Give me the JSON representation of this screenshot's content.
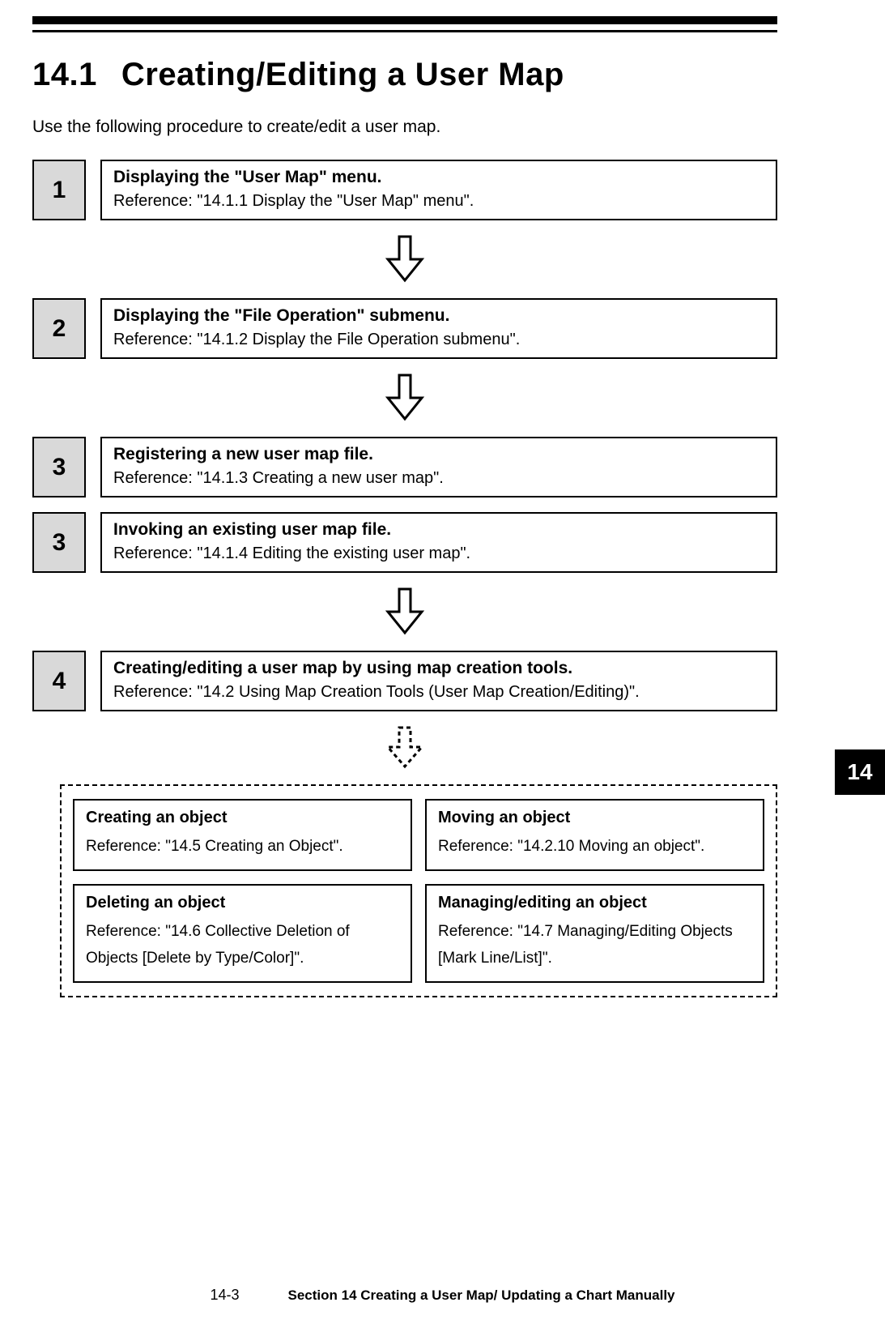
{
  "heading": {
    "number": "14.1",
    "title": "Creating/Editing a User Map"
  },
  "intro": "Use the following procedure to create/edit a user map.",
  "steps": [
    {
      "n": "1",
      "title": "Displaying the \"User Map\" menu.",
      "ref": "Reference: \"14.1.1 Display the \"User Map\" menu\"."
    },
    {
      "n": "2",
      "title": "Displaying the \"File Operation\" submenu.",
      "ref": "Reference: \"14.1.2 Display the File Operation submenu\"."
    },
    {
      "n": "3",
      "title": "Registering a new user map file.",
      "ref": "Reference: \"14.1.3 Creating a new user map\"."
    },
    {
      "n": "3",
      "title": "Invoking an existing user map file.",
      "ref": "Reference: \"14.1.4 Editing the existing user map\"."
    },
    {
      "n": "4",
      "title": "Creating/editing a user map by using map creation tools.",
      "ref": "Reference: \"14.2 Using Map Creation Tools (User Map Creation/Editing)\"."
    }
  ],
  "sub": {
    "a": {
      "title": "Creating an object",
      "ref": "Reference: \"14.5 Creating an Object\"."
    },
    "b": {
      "title": "Moving an object",
      "ref": "Reference: \"14.2.10 Moving an object\"."
    },
    "c": {
      "title": "Deleting an object",
      "ref": "Reference: \"14.6 Collective Deletion of Objects [Delete by Type/Color]\"."
    },
    "d": {
      "title": "Managing/editing an object",
      "ref": "Reference: \"14.7 Managing/Editing Objects [Mark Line/List]\"."
    }
  },
  "sideTab": "14",
  "footer": {
    "page": "14-3",
    "section": "Section 14    Creating a User Map/ Updating a Chart Manually"
  }
}
